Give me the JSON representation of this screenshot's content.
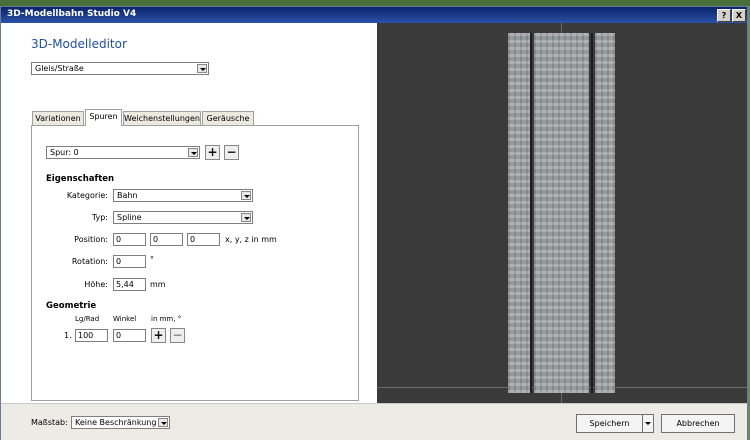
{
  "window": {
    "title": "3D-Modellbahn Studio V4",
    "help_label": "?",
    "close_label": "X"
  },
  "editor": {
    "heading": "3D-Modelleditor",
    "model_type": "Gleis/Straße"
  },
  "tabs": [
    {
      "label": "Variationen",
      "active": false
    },
    {
      "label": "Spuren",
      "active": true
    },
    {
      "label": "Weichenstellungen",
      "active": false
    },
    {
      "label": "Geräusche",
      "active": false
    }
  ],
  "spur": {
    "selected": "Spur: 0",
    "add_label": "+",
    "remove_label": "−"
  },
  "eigenschaften": {
    "heading": "Eigenschaften",
    "kategorie_label": "Kategorie:",
    "kategorie_value": "Bahn",
    "typ_label": "Typ:",
    "typ_value": "Spline",
    "position_label": "Position:",
    "position_x": "0",
    "position_y": "0",
    "position_z": "0",
    "position_unit": "x, y, z in mm",
    "rotation_label": "Rotation:",
    "rotation_value": "0",
    "rotation_unit": "°",
    "hoehe_label": "Höhe:",
    "hoehe_value": "5,44",
    "hoehe_unit": "mm"
  },
  "geometrie": {
    "heading": "Geometrie",
    "col_lgrad": "Lg/Rad",
    "col_winkel": "Winkel",
    "col_unit": "in mm, °",
    "rows": [
      {
        "index": "1.",
        "lgrad": "100",
        "winkel": "0"
      }
    ],
    "add_label": "+",
    "remove_label": "−"
  },
  "footer": {
    "massstab_label": "Maßstab:",
    "massstab_value": "Keine Beschränkung",
    "save_label": "Speichern",
    "cancel_label": "Abbrechen"
  },
  "colors": {
    "title_bar": "#0a246a",
    "heading_blue": "#2050a0",
    "viewport_bg": "#3a3a3a"
  }
}
